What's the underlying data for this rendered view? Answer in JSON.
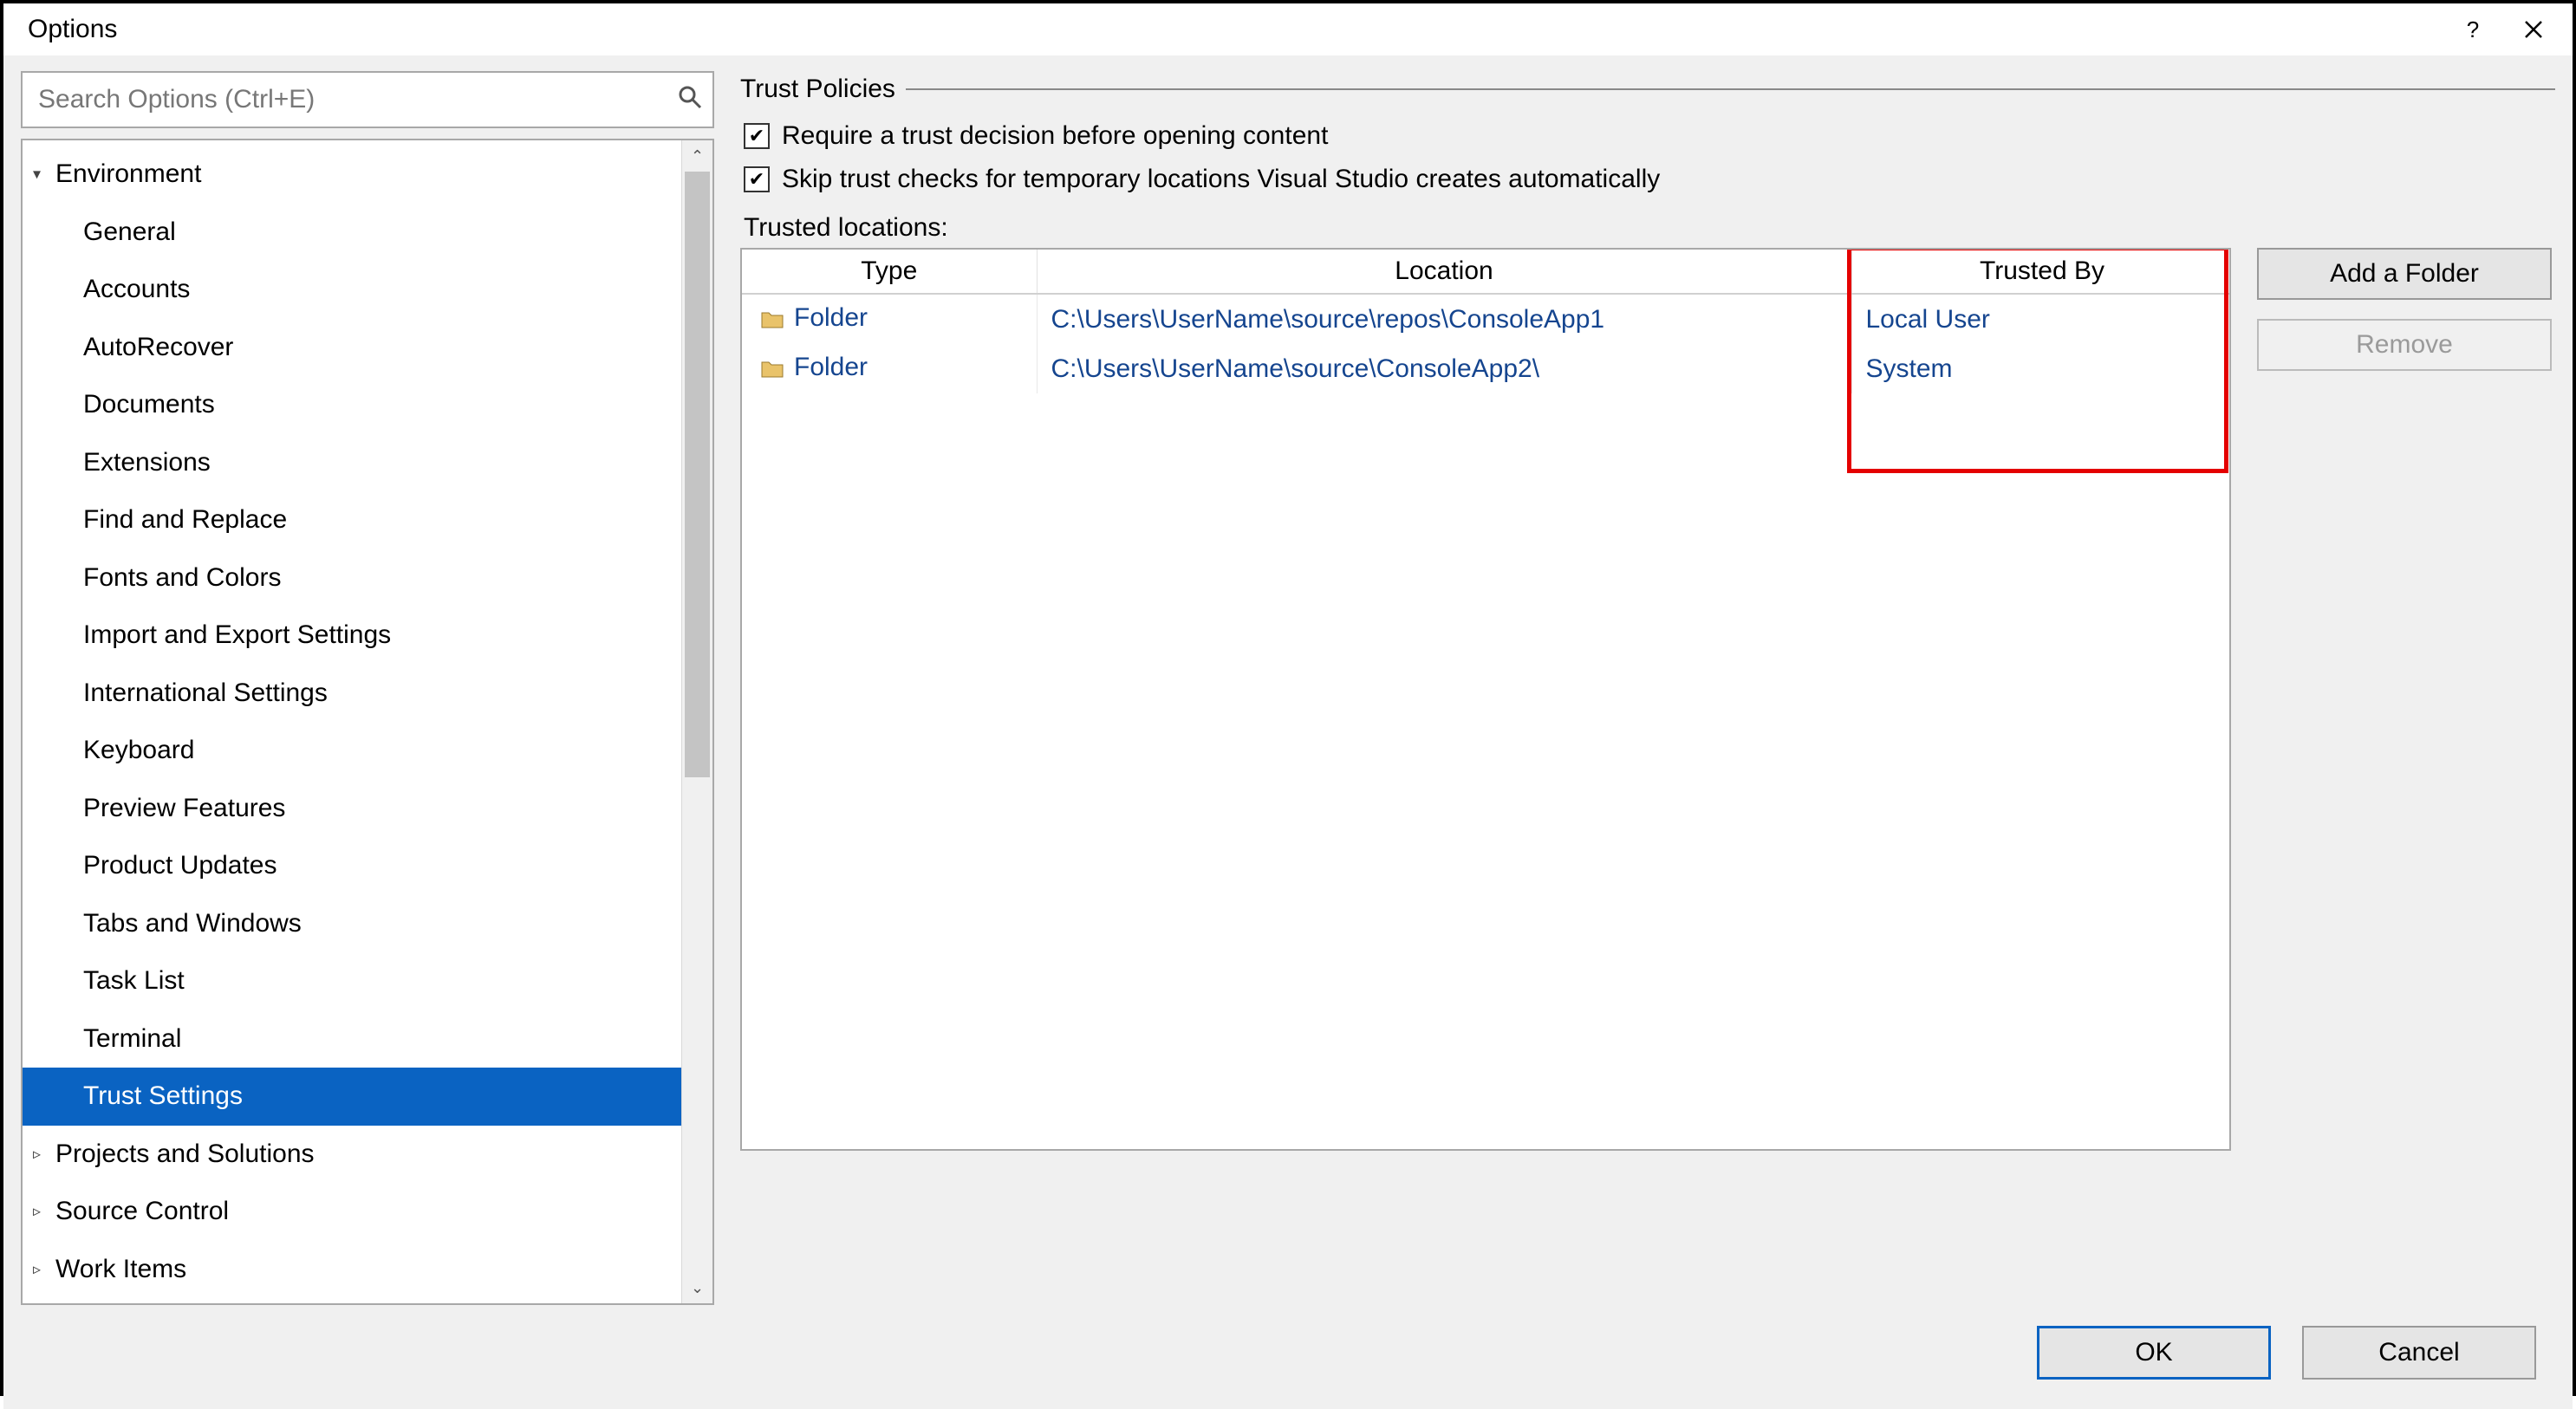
{
  "window": {
    "title": "Options"
  },
  "search": {
    "placeholder": "Search Options (Ctrl+E)"
  },
  "tree": {
    "items": [
      {
        "label": "Environment",
        "level": 0,
        "expanded": true
      },
      {
        "label": "General",
        "level": 1
      },
      {
        "label": "Accounts",
        "level": 1
      },
      {
        "label": "AutoRecover",
        "level": 1
      },
      {
        "label": "Documents",
        "level": 1
      },
      {
        "label": "Extensions",
        "level": 1
      },
      {
        "label": "Find and Replace",
        "level": 1
      },
      {
        "label": "Fonts and Colors",
        "level": 1
      },
      {
        "label": "Import and Export Settings",
        "level": 1
      },
      {
        "label": "International Settings",
        "level": 1
      },
      {
        "label": "Keyboard",
        "level": 1
      },
      {
        "label": "Preview Features",
        "level": 1
      },
      {
        "label": "Product Updates",
        "level": 1
      },
      {
        "label": "Tabs and Windows",
        "level": 1
      },
      {
        "label": "Task List",
        "level": 1
      },
      {
        "label": "Terminal",
        "level": 1
      },
      {
        "label": "Trust Settings",
        "level": 1,
        "selected": true
      },
      {
        "label": "Projects and Solutions",
        "level": 0,
        "expanded": false
      },
      {
        "label": "Source Control",
        "level": 0,
        "expanded": false
      },
      {
        "label": "Work Items",
        "level": 0,
        "expanded": false
      }
    ]
  },
  "section": {
    "title": "Trust Policies",
    "check1_label": "Require a trust decision before opening content",
    "check2_label": "Skip trust checks for temporary locations Visual Studio creates automatically",
    "trusted_locations_label": "Trusted locations:"
  },
  "table": {
    "headers": {
      "type": "Type",
      "location": "Location",
      "trusted_by": "Trusted By"
    },
    "rows": [
      {
        "type": "Folder",
        "location": "C:\\Users\\UserName\\source\\repos\\ConsoleApp1",
        "trusted_by": "Local User"
      },
      {
        "type": "Folder",
        "location": "C:\\Users\\UserName\\source\\ConsoleApp2\\",
        "trusted_by": "System"
      }
    ]
  },
  "buttons": {
    "add_folder": "Add a Folder",
    "remove": "Remove",
    "ok": "OK",
    "cancel": "Cancel"
  },
  "highlight": {
    "column": "trusted_by"
  }
}
